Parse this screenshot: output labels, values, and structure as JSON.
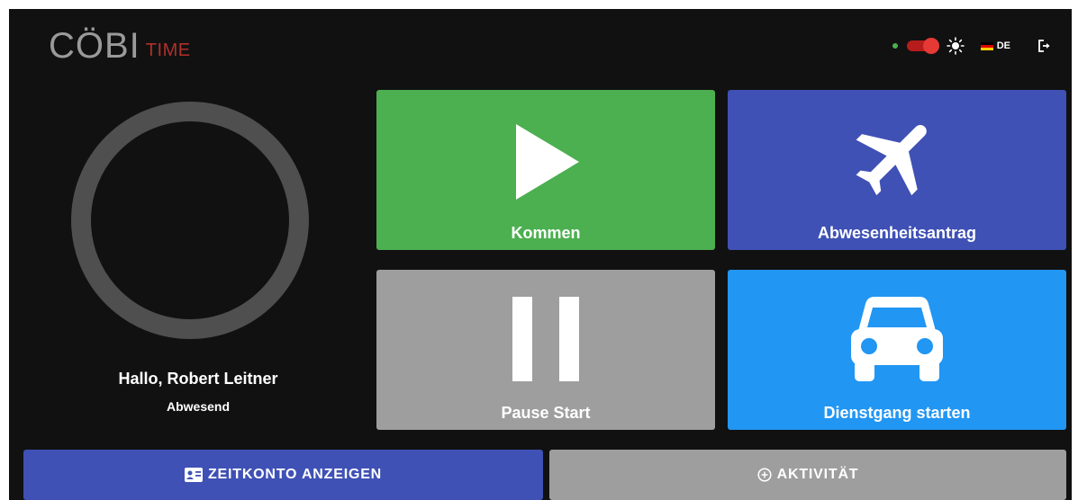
{
  "header": {
    "logo_main": "CÖBI",
    "logo_sub": "TIME",
    "language": "DE"
  },
  "colors": {
    "background": "#111111",
    "kommen": "#4caf50",
    "abwesenheitsantrag": "#3f51b5",
    "pause": "#9e9e9e",
    "dienstgang": "#2196f3",
    "zeitkonto": "#3f51b5",
    "aktivitaet": "#9e9e9e",
    "online_status": "#4caf50",
    "toggle": "#e53935"
  },
  "user": {
    "greeting": "Hallo, Robert Leitner",
    "status": "Abwesend"
  },
  "tiles": {
    "kommen": {
      "label": "Kommen",
      "icon": "play-icon"
    },
    "abwesenheitsantrag": {
      "label": "Abwesenheitsantrag",
      "icon": "airplane-icon"
    },
    "pause": {
      "label": "Pause Start",
      "icon": "pause-icon"
    },
    "dienstgang": {
      "label": "Dienstgang starten",
      "icon": "car-icon"
    }
  },
  "buttons": {
    "zeitkonto": {
      "label": "ZEITKONTO ANZEIGEN",
      "icon": "id-card-icon"
    },
    "aktivitaet": {
      "label": "AKTIVITÄT",
      "icon": "plus-circle-icon"
    }
  }
}
